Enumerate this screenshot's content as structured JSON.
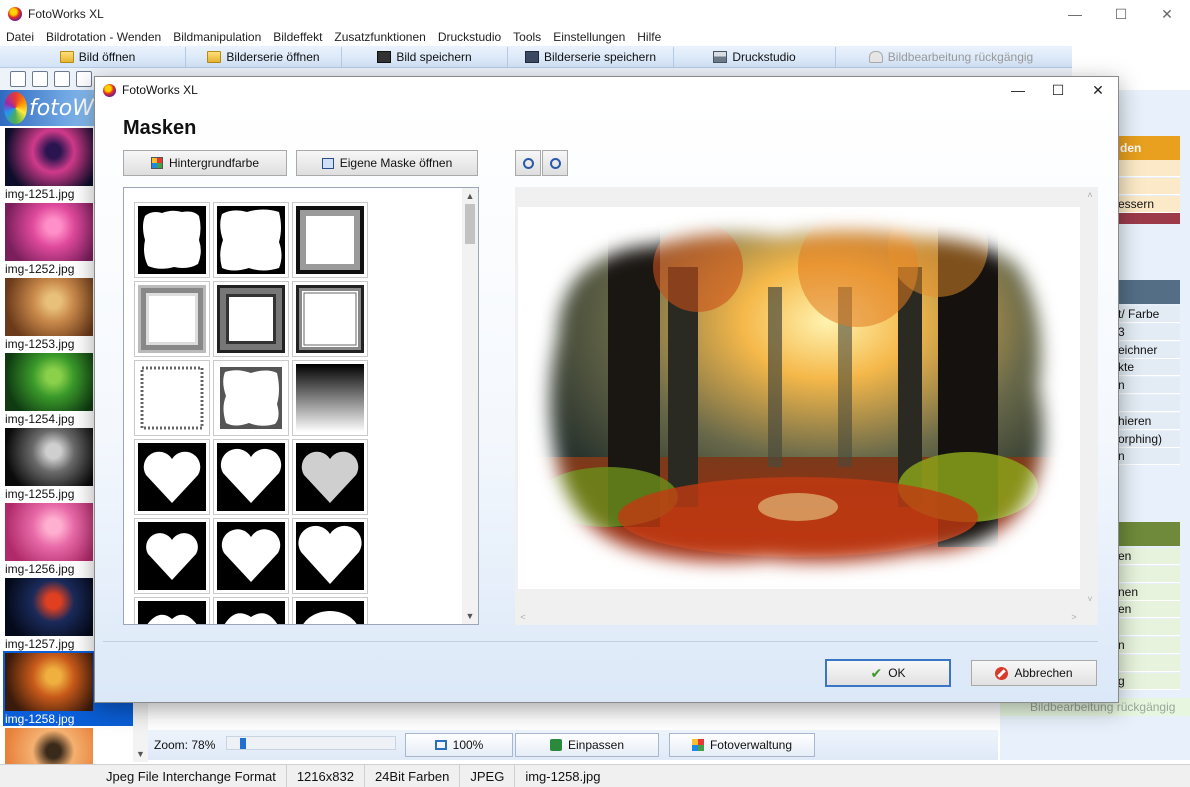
{
  "app": {
    "title": "FotoWorks XL",
    "logo_text": "fotoW",
    "menu": [
      "Datei",
      "Bildrotation - Wenden",
      "Bildmanipulation",
      "Bildeffekt",
      "Zusatzfunktionen",
      "Druckstudio",
      "Tools",
      "Einstellungen",
      "Hilfe"
    ],
    "toolbar": {
      "open_image": "Bild öffnen",
      "open_series": "Bilderserie öffnen",
      "save_image": "Bild speichern",
      "save_series": "Bilderserie speichern",
      "print_studio": "Druckstudio",
      "undo": "Bildbearbeitung rückgängig"
    }
  },
  "thumbnails": [
    {
      "label": "img-1251.jpg",
      "colors": [
        "#0d0d2a",
        "#d03a8a",
        "#2a1550"
      ]
    },
    {
      "label": "img-1252.jpg",
      "colors": [
        "#7a1f5c",
        "#e04a9c",
        "#ff8fc8"
      ]
    },
    {
      "label": "img-1253.jpg",
      "colors": [
        "#6a3a1a",
        "#c8884a",
        "#e8c07a"
      ]
    },
    {
      "label": "img-1254.jpg",
      "colors": [
        "#0f3a12",
        "#3a9a2a",
        "#8ad04a"
      ]
    },
    {
      "label": "img-1255.jpg",
      "colors": [
        "#0a0a0a",
        "#6a6a6a",
        "#cfcfcf"
      ]
    },
    {
      "label": "img-1256.jpg",
      "colors": [
        "#b02a6a",
        "#e86aa8",
        "#ffb0d0"
      ]
    },
    {
      "label": "img-1257.jpg",
      "colors": [
        "#050a1a",
        "#1a2a5a",
        "#e04020"
      ]
    },
    {
      "label": "img-1258.jpg",
      "colors": [
        "#3a1a0a",
        "#c85a1a",
        "#f0b040"
      ],
      "selected": true
    },
    {
      "label": "",
      "colors": [
        "#e8803a",
        "#f4b070",
        "#3a2a1a"
      ]
    }
  ],
  "side_panel": {
    "sections": [
      {
        "color": "#e8a01e",
        "text": "den"
      },
      {
        "color": "#9c3a4a",
        "text": ""
      },
      {
        "color": "#546e86",
        "text": ""
      },
      {
        "color": "#6e8a3a",
        "text": ""
      }
    ],
    "items_1": [
      "",
      "",
      "essern"
    ],
    "items_2": [
      "t/ Farbe",
      "3",
      "eichner",
      "kte",
      "n",
      "",
      "hieren",
      "orphing)",
      "n"
    ],
    "items_3": [
      "en",
      "",
      "nen",
      "en",
      "",
      "n",
      "",
      "g"
    ],
    "disabled": "Bildbearbeitung rückgängig"
  },
  "bottom": {
    "zoom_label": "Zoom: 78%",
    "zoom_level": 0.08,
    "btn_100": "100%",
    "btn_fit": "Einpassen",
    "btn_manager": "Fotoverwaltung"
  },
  "status": {
    "format": "Jpeg File Interchange Format",
    "size": "1216x832",
    "depth": "24Bit Farben",
    "type": "JPEG",
    "file": "img-1258.jpg"
  },
  "dialog": {
    "title": "FotoWorks XL",
    "heading": "Masken",
    "btn_bg": "Hintergrundfarbe",
    "btn_own_mask": "Eigene Maske öffnen",
    "ok": "OK",
    "cancel": "Abbrechen",
    "masks": [
      "rough-frame",
      "rough-frame-soft",
      "thick-frame",
      "bevel-frame",
      "bevel-frame-dark",
      "thin-frame",
      "dotted-frame",
      "splotch-frame",
      "gradient",
      "heart-bubbles",
      "heart-smooth",
      "heart-mosaic",
      "heart-bubbles-2",
      "heart-soft",
      "heart-solid",
      "partial-1",
      "partial-2",
      "partial-3"
    ]
  }
}
